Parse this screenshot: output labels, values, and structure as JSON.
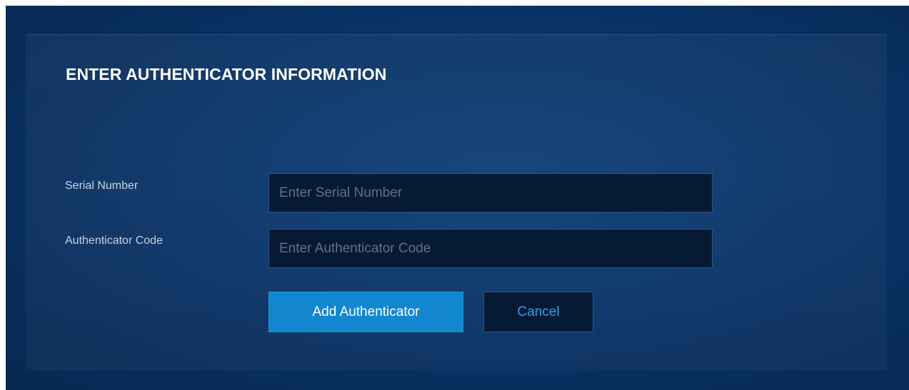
{
  "form": {
    "title": "ENTER AUTHENTICATOR INFORMATION",
    "serial_label": "Serial Number",
    "serial_placeholder": "Enter Serial Number",
    "serial_value": "",
    "code_label": "Authenticator Code",
    "code_placeholder": "Enter Authenticator Code",
    "code_value": "",
    "add_label": "Add Authenticator",
    "cancel_label": "Cancel"
  },
  "colors": {
    "background": "#0a3468",
    "field_background": "#071a33",
    "primary_button": "#1287d0",
    "cancel_text": "#2fa0f0"
  }
}
